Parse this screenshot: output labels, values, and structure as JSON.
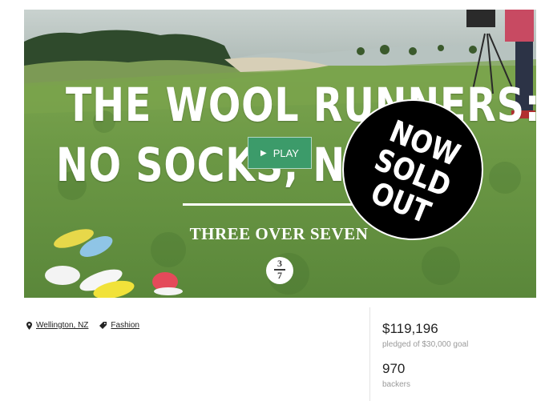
{
  "hero": {
    "title_line_1": "THE WOOL RUNNERS:",
    "title_line_2": "NO SOCKS, NO ....",
    "subtitle": "THREE OVER SEVEN",
    "logo_top": "3",
    "logo_bottom": "7",
    "play_label": "PLAY",
    "sold_line_1": "NOW",
    "sold_line_2": "SOLD",
    "sold_line_3": "OUT"
  },
  "meta": {
    "location": "Wellington, NZ",
    "category": "Fashion",
    "location_icon": "map-pin-icon",
    "category_icon": "tag-icon"
  },
  "stats": {
    "pledged": "$119,196",
    "pledged_label": "pledged of $30,000 goal",
    "backers": "970",
    "backers_label": "backers"
  },
  "colors": {
    "play_button": "#3c9b6a",
    "badge": "#000000",
    "grass": "#6f9a4a"
  }
}
